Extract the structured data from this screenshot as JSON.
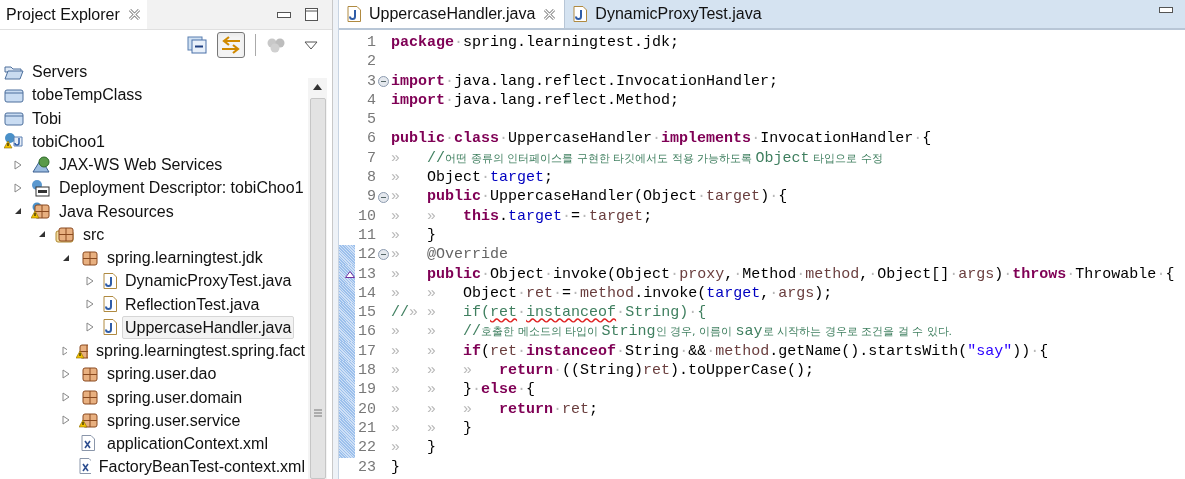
{
  "explorer": {
    "tab": {
      "title": "Project Explorer",
      "selected": true
    },
    "toolbar": {
      "link_with_editor": {
        "on": true
      }
    },
    "tree": [
      {
        "label": "Servers",
        "kind": "folder-open",
        "selected": false
      },
      {
        "label": "tobeTempClass",
        "kind": "folder",
        "selected": false
      },
      {
        "label": "Tobi",
        "kind": "folder",
        "selected": false
      },
      {
        "label": "tobiChoo1",
        "kind": "project",
        "selected": false,
        "children": [
          {
            "label": "JAX-WS Web Services",
            "kind": "webservice",
            "expanded": false,
            "selected": false
          },
          {
            "label": "Deployment Descriptor: tobiChoo1",
            "kind": "descriptor",
            "expanded": false,
            "selected": false
          },
          {
            "label": "Java Resources",
            "kind": "resources",
            "expanded": true,
            "selected": false,
            "children": [
              {
                "label": "src",
                "kind": "srcfolder",
                "expanded": true,
                "selected": false,
                "children": [
                  {
                    "label": "spring.learningtest.jdk",
                    "kind": "package",
                    "expanded": true,
                    "selected": false,
                    "children": [
                      {
                        "label": "DynamicProxyTest.java",
                        "kind": "java",
                        "expanded": false,
                        "selected": false
                      },
                      {
                        "label": "ReflectionTest.java",
                        "kind": "java",
                        "expanded": false,
                        "selected": false
                      },
                      {
                        "label": "UppercaseHandler.java",
                        "kind": "java",
                        "expanded": false,
                        "selected": true
                      }
                    ]
                  },
                  {
                    "label": "spring.learningtest.spring.fact",
                    "kind": "package",
                    "warning": true,
                    "expanded": false,
                    "selected": false
                  },
                  {
                    "label": "spring.user.dao",
                    "kind": "package",
                    "expanded": false,
                    "selected": false
                  },
                  {
                    "label": "spring.user.domain",
                    "kind": "package",
                    "expanded": false,
                    "selected": false
                  },
                  {
                    "label": "spring.user.service",
                    "kind": "package",
                    "warning": true,
                    "expanded": false,
                    "selected": false
                  },
                  {
                    "label": "applicationContext.xml",
                    "kind": "xml",
                    "selected": false
                  },
                  {
                    "label": "FactoryBeanTest-context.xml",
                    "kind": "xml",
                    "selected": false
                  }
                ]
              }
            ]
          }
        ]
      }
    ]
  },
  "editor": {
    "tabs": [
      {
        "title": "UppercaseHandler.java",
        "selected": true
      },
      {
        "title": "DynamicProxyTest.java",
        "selected": false
      }
    ],
    "lines": [
      {
        "number": "1",
        "tokens": [
          {
            "kind": "kw",
            "text": "package"
          },
          {
            "kind": "ws",
            "text": "·"
          },
          {
            "kind": "plain",
            "text": "spring.learningtest.jdk;"
          }
        ]
      },
      {
        "number": "2"
      },
      {
        "number": "3",
        "fold": true,
        "tokens": [
          {
            "kind": "kw",
            "text": "import"
          },
          {
            "kind": "ws",
            "text": "·"
          },
          {
            "kind": "plain",
            "text": "java.lang.reflect.InvocationHandler;"
          }
        ]
      },
      {
        "number": "4",
        "tokens": [
          {
            "kind": "kw",
            "text": "import"
          },
          {
            "kind": "ws",
            "text": "·"
          },
          {
            "kind": "plain",
            "text": "java.lang.reflect.Method;"
          }
        ]
      },
      {
        "number": "5"
      },
      {
        "number": "6",
        "tokens": [
          {
            "kind": "kw",
            "text": "public"
          },
          {
            "kind": "ws",
            "text": "·"
          },
          {
            "kind": "kw",
            "text": "class"
          },
          {
            "kind": "ws",
            "text": "·"
          },
          {
            "kind": "plain",
            "text": "UppercaseHandler"
          },
          {
            "kind": "ws",
            "text": "·"
          },
          {
            "kind": "kw",
            "text": "implements"
          },
          {
            "kind": "ws",
            "text": "·"
          },
          {
            "kind": "plain",
            "text": "InvocationHandler"
          },
          {
            "kind": "ws",
            "text": "·"
          },
          {
            "kind": "plain",
            "text": "{"
          }
        ]
      },
      {
        "number": "7",
        "tokens": [
          {
            "kind": "ws",
            "text": "»   "
          },
          {
            "kind": "cmt",
            "text": "//"
          },
          {
            "kind": "cmtk",
            "text": "어떤 종류의 인터페이스를 구현한 타깃에서도 적용 가능하도록 "
          },
          {
            "kind": "cmt",
            "text": "Object"
          },
          {
            "kind": "cmtk",
            "text": " 타입으로 수정"
          }
        ]
      },
      {
        "number": "8",
        "tokens": [
          {
            "kind": "ws",
            "text": "»   "
          },
          {
            "kind": "plain",
            "text": "Object"
          },
          {
            "kind": "ws",
            "text": "·"
          },
          {
            "kind": "field",
            "text": "target"
          },
          {
            "kind": "plain",
            "text": ";"
          }
        ]
      },
      {
        "number": "9",
        "fold": true,
        "tokens": [
          {
            "kind": "ws",
            "text": "»   "
          },
          {
            "kind": "kw",
            "text": "public"
          },
          {
            "kind": "ws",
            "text": "·"
          },
          {
            "kind": "plain",
            "text": "UppercaseHandler(Object"
          },
          {
            "kind": "ws",
            "text": "·"
          },
          {
            "kind": "var",
            "text": "target"
          },
          {
            "kind": "plain",
            "text": ")"
          },
          {
            "kind": "ws",
            "text": "·"
          },
          {
            "kind": "plain",
            "text": "{"
          }
        ]
      },
      {
        "number": "10",
        "tokens": [
          {
            "kind": "ws",
            "text": "»   »   "
          },
          {
            "kind": "kw",
            "text": "this"
          },
          {
            "kind": "plain",
            "text": "."
          },
          {
            "kind": "field",
            "text": "target"
          },
          {
            "kind": "ws",
            "text": "·"
          },
          {
            "kind": "plain",
            "text": "="
          },
          {
            "kind": "ws",
            "text": "·"
          },
          {
            "kind": "var",
            "text": "target"
          },
          {
            "kind": "plain",
            "text": ";"
          }
        ]
      },
      {
        "number": "11",
        "tokens": [
          {
            "kind": "ws",
            "text": "»   "
          },
          {
            "kind": "plain",
            "text": "}"
          }
        ]
      },
      {
        "number": "12",
        "fold": true,
        "changed": true,
        "tokens": [
          {
            "kind": "ws",
            "text": "»   "
          },
          {
            "kind": "ann",
            "text": "@Override"
          }
        ]
      },
      {
        "number": "13",
        "changed": true,
        "override": true,
        "tokens": [
          {
            "kind": "ws",
            "text": "»   "
          },
          {
            "kind": "kw",
            "text": "public"
          },
          {
            "kind": "ws",
            "text": "·"
          },
          {
            "kind": "plain",
            "text": "Object"
          },
          {
            "kind": "ws",
            "text": "·"
          },
          {
            "kind": "plain",
            "text": "invoke(Object"
          },
          {
            "kind": "ws",
            "text": "·"
          },
          {
            "kind": "var",
            "text": "proxy"
          },
          {
            "kind": "plain",
            "text": ","
          },
          {
            "kind": "ws",
            "text": "·"
          },
          {
            "kind": "plain",
            "text": "Method"
          },
          {
            "kind": "ws",
            "text": "·"
          },
          {
            "kind": "var",
            "text": "method"
          },
          {
            "kind": "plain",
            "text": ","
          },
          {
            "kind": "ws",
            "text": "·"
          },
          {
            "kind": "plain",
            "text": "Object[]"
          },
          {
            "kind": "ws",
            "text": "·"
          },
          {
            "kind": "var",
            "text": "args"
          },
          {
            "kind": "plain",
            "text": ")"
          },
          {
            "kind": "ws",
            "text": "·"
          },
          {
            "kind": "kw",
            "text": "throws"
          },
          {
            "kind": "ws",
            "text": "·"
          },
          {
            "kind": "plain",
            "text": "Throwable"
          },
          {
            "kind": "ws",
            "text": "·"
          },
          {
            "kind": "plain",
            "text": "{"
          }
        ]
      },
      {
        "number": "14",
        "changed": true,
        "tokens": [
          {
            "kind": "ws",
            "text": "»   »   "
          },
          {
            "kind": "plain",
            "text": "Object"
          },
          {
            "kind": "ws",
            "text": "·"
          },
          {
            "kind": "var",
            "text": "ret"
          },
          {
            "kind": "ws",
            "text": "·"
          },
          {
            "kind": "plain",
            "text": "="
          },
          {
            "kind": "ws",
            "text": "·"
          },
          {
            "kind": "var",
            "text": "method"
          },
          {
            "kind": "plain",
            "text": ".invoke("
          },
          {
            "kind": "field",
            "text": "target"
          },
          {
            "kind": "plain",
            "text": ","
          },
          {
            "kind": "ws",
            "text": "·"
          },
          {
            "kind": "var",
            "text": "args"
          },
          {
            "kind": "plain",
            "text": ");"
          }
        ]
      },
      {
        "number": "15",
        "changed": true,
        "tokens": [
          {
            "kind": "cmt",
            "text": "//"
          },
          {
            "kind": "ws",
            "text": "» "
          },
          {
            "kind": "ws",
            "text": "»   "
          },
          {
            "kind": "cmt",
            "text": "if("
          },
          {
            "kind": "err",
            "text": "ret"
          },
          {
            "kind": "ws",
            "text": "·"
          },
          {
            "kind": "err",
            "text": "instanceof"
          },
          {
            "kind": "ws",
            "text": "·"
          },
          {
            "kind": "cmt",
            "text": "String)"
          },
          {
            "kind": "ws",
            "text": "·"
          },
          {
            "kind": "cmt",
            "text": "{"
          }
        ]
      },
      {
        "number": "16",
        "changed": true,
        "tokens": [
          {
            "kind": "ws",
            "text": "»   »   "
          },
          {
            "kind": "cmt",
            "text": "//"
          },
          {
            "kind": "cmtk",
            "text": "호출한 메소드의 타입이 "
          },
          {
            "kind": "cmt",
            "text": "String"
          },
          {
            "kind": "cmtk",
            "text": "인 경우, 이름이 "
          },
          {
            "kind": "cmt",
            "text": "say"
          },
          {
            "kind": "cmtk",
            "text": "로 시작하는 경우로 조건을 걸 수 있다."
          }
        ]
      },
      {
        "number": "17",
        "changed": true,
        "tokens": [
          {
            "kind": "ws",
            "text": "»   »   "
          },
          {
            "kind": "kw",
            "text": "if"
          },
          {
            "kind": "plain",
            "text": "("
          },
          {
            "kind": "var",
            "text": "ret"
          },
          {
            "kind": "ws",
            "text": "·"
          },
          {
            "kind": "kw",
            "text": "instanceof"
          },
          {
            "kind": "ws",
            "text": "·"
          },
          {
            "kind": "plain",
            "text": "String"
          },
          {
            "kind": "ws",
            "text": "·"
          },
          {
            "kind": "plain",
            "text": "&&"
          },
          {
            "kind": "ws",
            "text": "·"
          },
          {
            "kind": "var",
            "text": "method"
          },
          {
            "kind": "plain",
            "text": ".getName().startsWith("
          },
          {
            "kind": "str",
            "text": "\"say\""
          },
          {
            "kind": "plain",
            "text": "))"
          },
          {
            "kind": "ws",
            "text": "·"
          },
          {
            "kind": "plain",
            "text": "{"
          }
        ]
      },
      {
        "number": "18",
        "changed": true,
        "tokens": [
          {
            "kind": "ws",
            "text": "»   »   »   "
          },
          {
            "kind": "kw",
            "text": "return"
          },
          {
            "kind": "ws",
            "text": "·"
          },
          {
            "kind": "plain",
            "text": "((String)"
          },
          {
            "kind": "var",
            "text": "ret"
          },
          {
            "kind": "plain",
            "text": ").toUpperCase();"
          }
        ]
      },
      {
        "number": "19",
        "changed": true,
        "tokens": [
          {
            "kind": "ws",
            "text": "»   »   "
          },
          {
            "kind": "plain",
            "text": "}"
          },
          {
            "kind": "ws",
            "text": "·"
          },
          {
            "kind": "kw",
            "text": "else"
          },
          {
            "kind": "ws",
            "text": "·"
          },
          {
            "kind": "plain",
            "text": "{"
          }
        ]
      },
      {
        "number": "20",
        "changed": true,
        "tokens": [
          {
            "kind": "ws",
            "text": "»   »   »   "
          },
          {
            "kind": "kw",
            "text": "return"
          },
          {
            "kind": "ws",
            "text": "·"
          },
          {
            "kind": "var",
            "text": "ret"
          },
          {
            "kind": "plain",
            "text": ";"
          }
        ]
      },
      {
        "number": "21",
        "changed": true,
        "tokens": [
          {
            "kind": "ws",
            "text": "»   »   "
          },
          {
            "kind": "plain",
            "text": "}"
          }
        ]
      },
      {
        "number": "22",
        "changed": true,
        "tokens": [
          {
            "kind": "ws",
            "text": "»   "
          },
          {
            "kind": "plain",
            "text": "}"
          }
        ]
      },
      {
        "number": "23",
        "tokens": [
          {
            "kind": "plain",
            "text": "}"
          }
        ]
      }
    ]
  }
}
